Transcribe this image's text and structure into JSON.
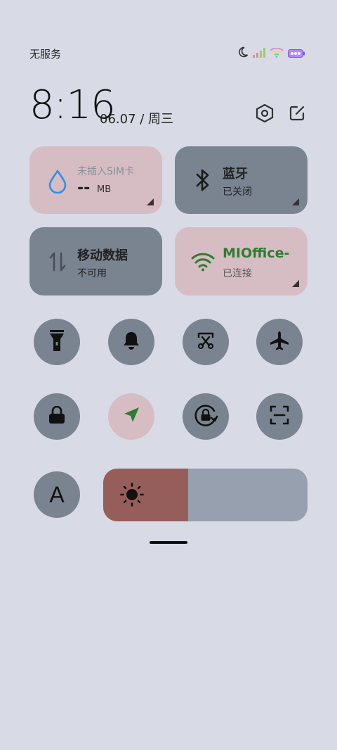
{
  "status_bar": {
    "carrier_text": "无服务",
    "icons": [
      "moon-icon",
      "signal-icon",
      "wifi-icon",
      "battery-icon"
    ]
  },
  "header": {
    "time": "8:16",
    "date": "06.07 / 周三",
    "icons": [
      "settings-icon",
      "edit-icon"
    ]
  },
  "tiles": {
    "sim": {
      "title": "未插入SIM卡",
      "value": "--",
      "unit": "MB",
      "icon": "water-drop-icon"
    },
    "bluetooth": {
      "title": "蓝牙",
      "status": "已关闭",
      "icon": "bluetooth-icon"
    },
    "mobile_data": {
      "title": "移动数据",
      "status": "不可用",
      "icon": "data-arrows-icon"
    },
    "wifi": {
      "title": "MIOffice-",
      "status": "已连接",
      "icon": "wifi-icon",
      "accent": "#2e7d32"
    }
  },
  "toggles_row1": [
    "flashlight-icon",
    "bell-icon",
    "screenshot-icon",
    "airplane-icon"
  ],
  "toggles_row2": [
    "lock-icon",
    "location-icon",
    "rotation-lock-icon",
    "scan-icon"
  ],
  "brightness": {
    "level": 0.415,
    "icon": "sun-icon",
    "fill_color": "#965e5a"
  },
  "font_button": {
    "label": "A"
  }
}
